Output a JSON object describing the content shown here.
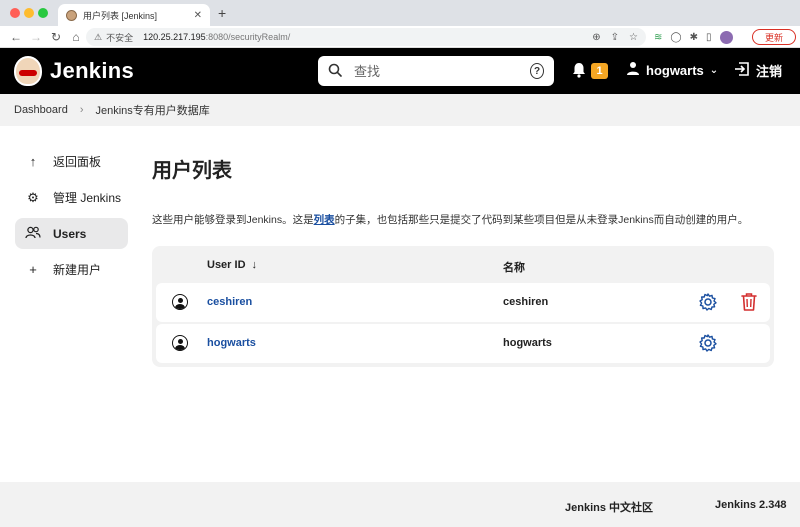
{
  "browser": {
    "tab_title": "用户列表 [Jenkins]",
    "tab_close": "✕",
    "new_tab": "+",
    "insecure_label": "不安全",
    "url_host": "120.25.217.195",
    "url_rest": ":8080/securityRealm/",
    "update_label": "更新"
  },
  "header": {
    "logo_text": "Jenkins",
    "search_placeholder": "查找",
    "help_glyph": "?",
    "notification_count": "1",
    "username": "hogwarts",
    "logout_label": "注销"
  },
  "breadcrumb": {
    "items": [
      "Dashboard",
      "Jenkins专有用户数据库"
    ],
    "separator": "›"
  },
  "sidebar": {
    "items": [
      {
        "label": "返回面板",
        "icon": "arrow-up-icon",
        "glyph": "↑"
      },
      {
        "label": "管理 Jenkins",
        "icon": "gear-icon",
        "glyph": "⚙"
      },
      {
        "label": "Users",
        "icon": "users-icon",
        "glyph": "👥",
        "active": true
      },
      {
        "label": "新建用户",
        "icon": "plus-icon",
        "glyph": "+"
      }
    ]
  },
  "main": {
    "title": "用户列表",
    "description_before": "这些用户能够登录到Jenkins。这是",
    "description_link": "列表",
    "description_after": "的子集，也包括那些只是提交了代码到某些项目但是从未登录Jenkins而自动创建的用户。"
  },
  "table": {
    "columns": [
      "User ID",
      "名称"
    ],
    "sort_arrow": "↓",
    "rows": [
      {
        "user_id": "ceshiren",
        "name": "ceshiren",
        "deletable": true
      },
      {
        "user_id": "hogwarts",
        "name": "hogwarts",
        "deletable": false
      }
    ]
  },
  "colors": {
    "link": "#1a4fa0",
    "delete": "#d32f2f",
    "badge": "#f5a623"
  },
  "footer": {
    "community": "Jenkins 中文社区",
    "version": "Jenkins 2.348"
  }
}
